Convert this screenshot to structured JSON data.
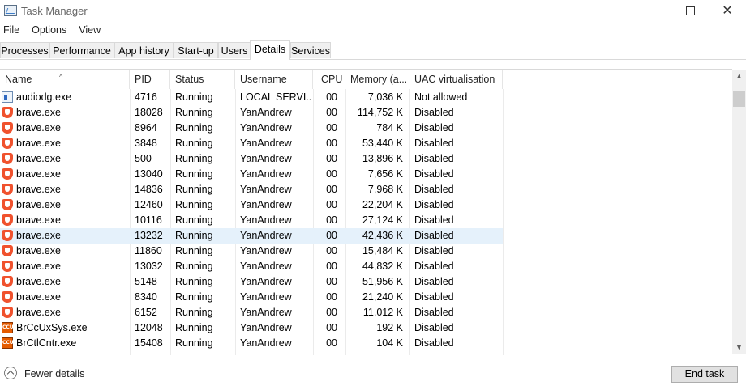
{
  "window": {
    "title": "Task Manager"
  },
  "menu": [
    "File",
    "Options",
    "View"
  ],
  "tabs": [
    "Processes",
    "Performance",
    "App history",
    "Start-up",
    "Users",
    "Details",
    "Services"
  ],
  "active_tab": "Details",
  "columns": [
    "Name",
    "PID",
    "Status",
    "Username",
    "CPU",
    "Memory (a...",
    "UAC virtualisation"
  ],
  "rows": [
    {
      "icon": "generic-process-icon",
      "name": "audiodg.exe",
      "pid": "4716",
      "status": "Running",
      "user": "LOCAL SERVI...",
      "cpu": "00",
      "mem": "7,036 K",
      "uac": "Not allowed"
    },
    {
      "icon": "brave-icon",
      "name": "brave.exe",
      "pid": "18028",
      "status": "Running",
      "user": "YanAndrew",
      "cpu": "00",
      "mem": "114,752 K",
      "uac": "Disabled"
    },
    {
      "icon": "brave-icon",
      "name": "brave.exe",
      "pid": "8964",
      "status": "Running",
      "user": "YanAndrew",
      "cpu": "00",
      "mem": "784 K",
      "uac": "Disabled"
    },
    {
      "icon": "brave-icon",
      "name": "brave.exe",
      "pid": "3848",
      "status": "Running",
      "user": "YanAndrew",
      "cpu": "00",
      "mem": "53,440 K",
      "uac": "Disabled"
    },
    {
      "icon": "brave-icon",
      "name": "brave.exe",
      "pid": "500",
      "status": "Running",
      "user": "YanAndrew",
      "cpu": "00",
      "mem": "13,896 K",
      "uac": "Disabled"
    },
    {
      "icon": "brave-icon",
      "name": "brave.exe",
      "pid": "13040",
      "status": "Running",
      "user": "YanAndrew",
      "cpu": "00",
      "mem": "7,656 K",
      "uac": "Disabled"
    },
    {
      "icon": "brave-icon",
      "name": "brave.exe",
      "pid": "14836",
      "status": "Running",
      "user": "YanAndrew",
      "cpu": "00",
      "mem": "7,968 K",
      "uac": "Disabled"
    },
    {
      "icon": "brave-icon",
      "name": "brave.exe",
      "pid": "12460",
      "status": "Running",
      "user": "YanAndrew",
      "cpu": "00",
      "mem": "22,204 K",
      "uac": "Disabled"
    },
    {
      "icon": "brave-icon",
      "name": "brave.exe",
      "pid": "10116",
      "status": "Running",
      "user": "YanAndrew",
      "cpu": "00",
      "mem": "27,124 K",
      "uac": "Disabled"
    },
    {
      "icon": "brave-icon",
      "name": "brave.exe",
      "pid": "13232",
      "status": "Running",
      "user": "YanAndrew",
      "cpu": "00",
      "mem": "42,436 K",
      "uac": "Disabled",
      "selected": true
    },
    {
      "icon": "brave-icon",
      "name": "brave.exe",
      "pid": "11860",
      "status": "Running",
      "user": "YanAndrew",
      "cpu": "00",
      "mem": "15,484 K",
      "uac": "Disabled"
    },
    {
      "icon": "brave-icon",
      "name": "brave.exe",
      "pid": "13032",
      "status": "Running",
      "user": "YanAndrew",
      "cpu": "00",
      "mem": "44,832 K",
      "uac": "Disabled"
    },
    {
      "icon": "brave-icon",
      "name": "brave.exe",
      "pid": "5148",
      "status": "Running",
      "user": "YanAndrew",
      "cpu": "00",
      "mem": "51,956 K",
      "uac": "Disabled"
    },
    {
      "icon": "brave-icon",
      "name": "brave.exe",
      "pid": "8340",
      "status": "Running",
      "user": "YanAndrew",
      "cpu": "00",
      "mem": "21,240 K",
      "uac": "Disabled"
    },
    {
      "icon": "brave-icon",
      "name": "brave.exe",
      "pid": "6152",
      "status": "Running",
      "user": "YanAndrew",
      "cpu": "00",
      "mem": "11,012 K",
      "uac": "Disabled"
    },
    {
      "icon": "ccu-icon",
      "name": "BrCcUxSys.exe",
      "pid": "12048",
      "status": "Running",
      "user": "YanAndrew",
      "cpu": "00",
      "mem": "192 K",
      "uac": "Disabled"
    },
    {
      "icon": "ccu-icon",
      "name": "BrCtlCntr.exe",
      "pid": "15408",
      "status": "Running",
      "user": "YanAndrew",
      "cpu": "00",
      "mem": "104 K",
      "uac": "Disabled"
    }
  ],
  "footer": {
    "fewer_details": "Fewer details",
    "end_task": "End task"
  },
  "colors": {
    "selected_row": "#e5f1fb",
    "brave": "#f0522e"
  }
}
